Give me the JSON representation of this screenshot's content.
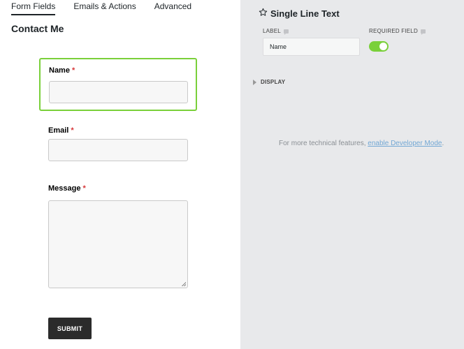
{
  "tabs": [
    {
      "label": "Form Fields"
    },
    {
      "label": "Emails & Actions"
    },
    {
      "label": "Advanced"
    }
  ],
  "form": {
    "title": "Contact Me",
    "required_marker": "*",
    "fields": [
      {
        "label": "Name",
        "value": ""
      },
      {
        "label": "Email",
        "value": ""
      },
      {
        "label": "Message",
        "value": ""
      }
    ],
    "submit_label": "SUBMIT"
  },
  "panel": {
    "title": "Single Line Text",
    "label_heading": "LABEL",
    "label_value": "Name",
    "required_heading": "REQUIRED FIELD",
    "required_on": true,
    "display_heading": "DISPLAY",
    "dev_note_text": "For more technical features, ",
    "dev_link_text": "enable Developer Mode",
    "dev_note_end": "."
  },
  "colors": {
    "accent_green": "#7ad03a",
    "required_red": "#d63638",
    "link_blue": "#72a7d4",
    "panel_bg": "#e8e9eb"
  }
}
